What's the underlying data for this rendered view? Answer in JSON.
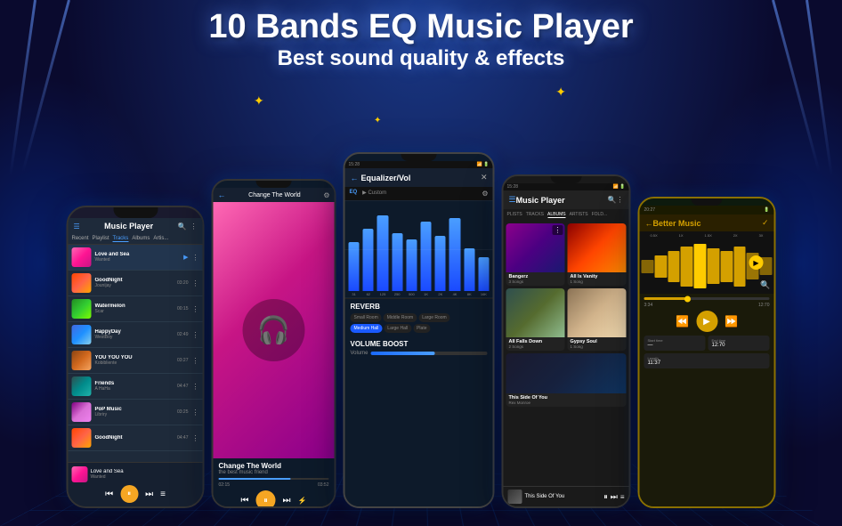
{
  "header": {
    "main_title": "10 Bands EQ Music Player",
    "sub_title": "Best sound quality & effects"
  },
  "phone1": {
    "title": "Music Player",
    "tabs": [
      "Recent",
      "Playlist",
      "Tracks",
      "Albums",
      "Artists"
    ],
    "active_tab": "Tracks",
    "tracks": [
      {
        "name": "Love and Sea Wanted",
        "artist": "Wanted",
        "duration": "",
        "cover_class": "cover-love"
      },
      {
        "name": "GoodNight",
        "artist": "Jounijay",
        "duration": "03:20",
        "cover_class": "cover-goodnight"
      },
      {
        "name": "Watermelon",
        "artist": "Scar",
        "duration": "00:15",
        "cover_class": "cover-watermelon"
      },
      {
        "name": "HappyDay",
        "artist": "WestBoy",
        "duration": "02:49",
        "cover_class": "cover-happy"
      },
      {
        "name": "YOU YOU YOU",
        "artist": "Kobibliente",
        "duration": "03:27",
        "cover_class": "cover-youyouyou"
      },
      {
        "name": "Friends",
        "artist": "A HaHa",
        "duration": "04:47",
        "cover_class": "cover-friends"
      },
      {
        "name": "PoP Music",
        "artist": "Libriry",
        "duration": "03:25",
        "cover_class": "cover-pop"
      },
      {
        "name": "GoodNight",
        "artist": "",
        "duration": "04:47",
        "cover_class": "cover-goodnight"
      },
      {
        "name": "Love and Sea",
        "artist": "Wanted",
        "duration": "",
        "cover_class": "cover-love"
      }
    ],
    "now_playing": "Love and Sea"
  },
  "phone2": {
    "title": "Change The World",
    "subtitle": "the best music friend",
    "time": "03:52"
  },
  "phone3": {
    "title": "Equalizer/Vol",
    "tabs": [
      "EQ",
      "Custom"
    ],
    "eq_bars": [
      {
        "label": "31",
        "height": 55
      },
      {
        "label": "62",
        "height": 75
      },
      {
        "label": "125",
        "height": 90
      },
      {
        "label": "250",
        "height": 70
      },
      {
        "label": "500",
        "height": 60
      },
      {
        "label": "1K",
        "height": 80
      },
      {
        "label": "2K",
        "height": 65
      },
      {
        "label": "4K",
        "height": 85
      },
      {
        "label": "8K",
        "height": 50
      },
      {
        "label": "16K",
        "height": 40
      }
    ],
    "reverb": {
      "title": "REVERB",
      "options": [
        "Small Room",
        "Middle Room",
        "Large Room",
        "Medium Hall",
        "Large Hall",
        "Plate"
      ],
      "active": "Medium Hall"
    },
    "volume": {
      "title": "VOLUME BOOST",
      "label": "Volume"
    }
  },
  "phone4": {
    "title": "Music Player",
    "tabs": [
      "PLISTS",
      "TRACKS",
      "ALBUMS",
      "ARTISTS",
      "FOLD..."
    ],
    "active_tab": "ALBUMS",
    "albums": [
      {
        "name": "Bangerz",
        "songs": "3 Songs",
        "cover_class": "cover-bangerz"
      },
      {
        "name": "All Is Vanity",
        "songs": "1 Song",
        "cover_class": "cover-vanity"
      },
      {
        "name": "All Falls Down",
        "songs": "2 Songs",
        "cover_class": "cover-falls"
      },
      {
        "name": "Gypsy Soul",
        "songs": "1 Song",
        "cover_class": "cover-gypsy"
      },
      {
        "name": "This Side Of You",
        "songs": "",
        "cover_class": "cover-thisSide"
      }
    ],
    "bottom_artist": "Rex Monroe"
  },
  "phone5": {
    "title": "Better Music",
    "time_start": "20:27",
    "current_time": "3:34",
    "total_time": "12:70",
    "length": "11:37",
    "start_time_label": "Start time",
    "end_time_label": "End time",
    "length_label": "Length"
  },
  "sparkles": [
    "✦",
    "✦",
    "✦",
    "✦"
  ]
}
